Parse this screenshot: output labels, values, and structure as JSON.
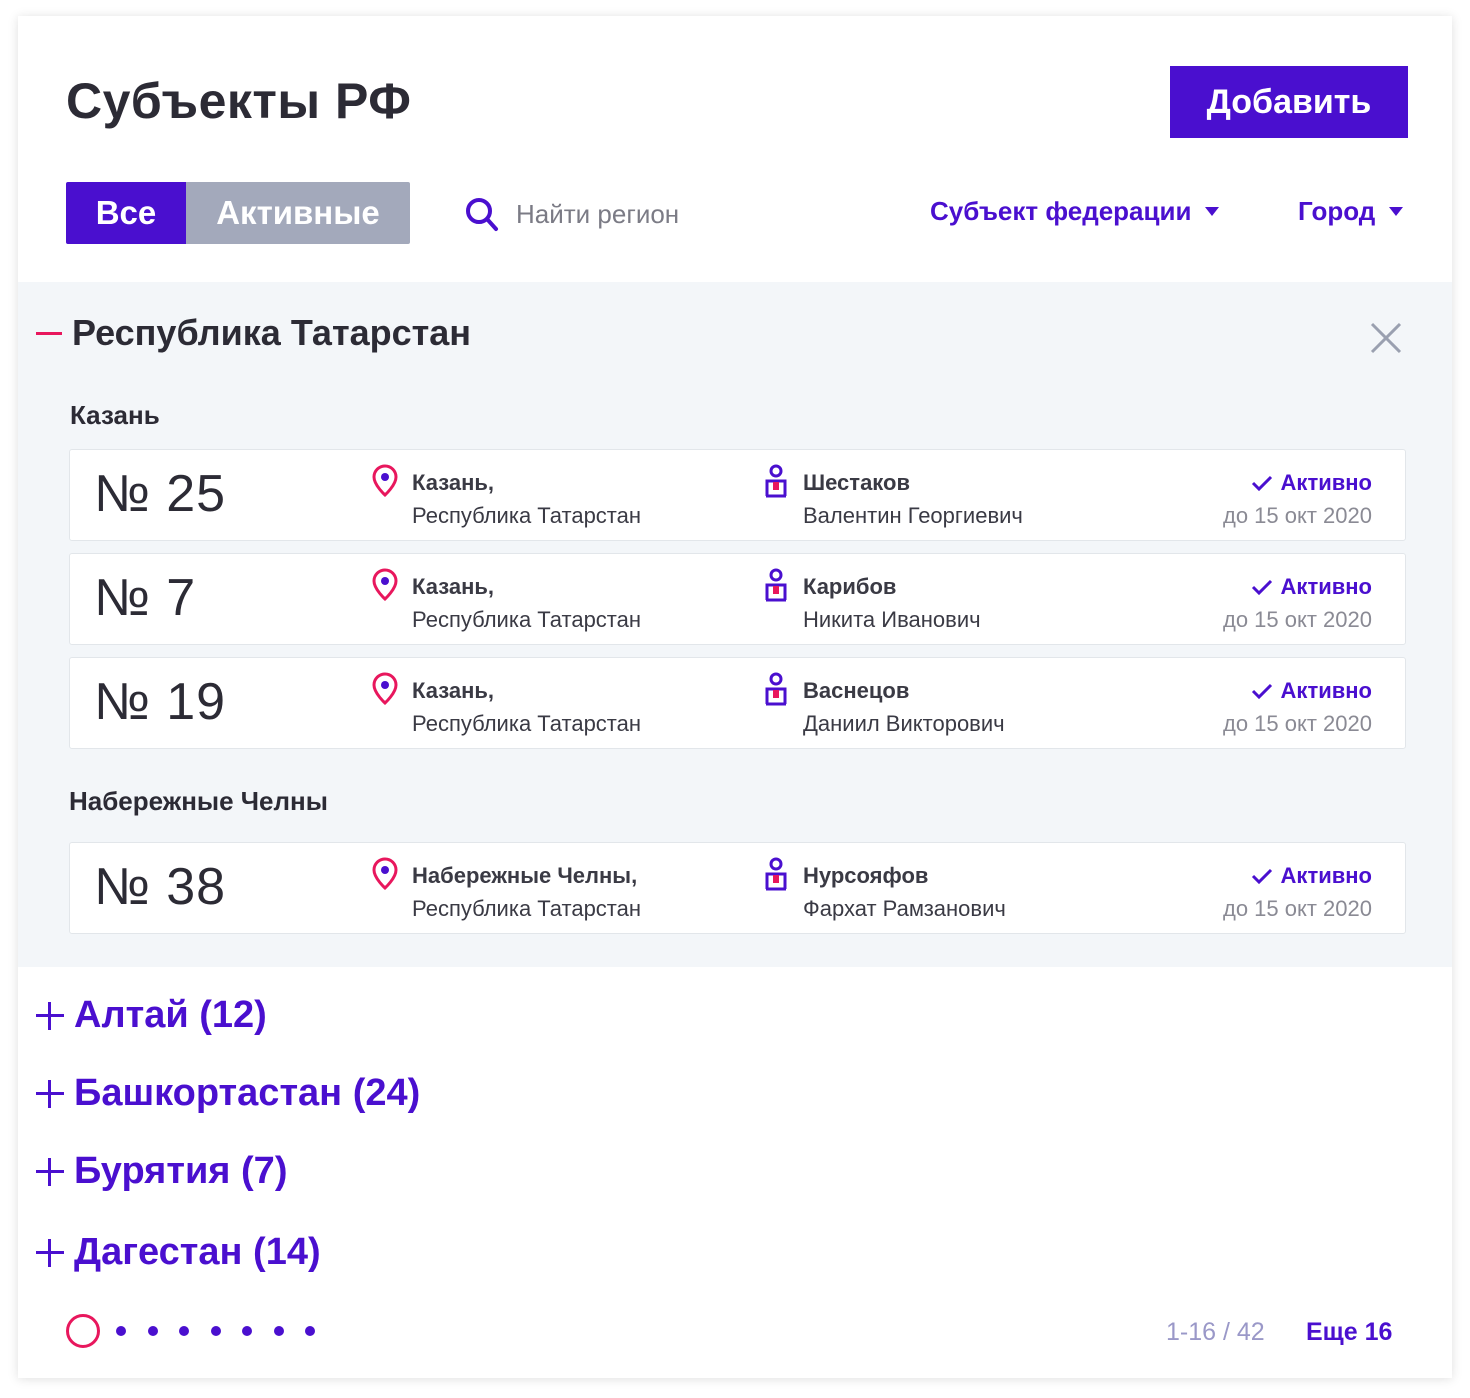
{
  "header": {
    "title": "Субъекты РФ",
    "add_label": "Добавить"
  },
  "filters": {
    "tabs": [
      {
        "label": "Все",
        "selected": true
      },
      {
        "label": "Активные",
        "selected": false
      }
    ],
    "search_placeholder": "Найти регион",
    "dropdown_subject": "Субъект федерации",
    "dropdown_city": "Город"
  },
  "expanded_region": {
    "title": "Республика Татарстан",
    "groups": [
      {
        "city": "Казань",
        "cards": [
          {
            "number": "№ 25",
            "loc1": "Казань,",
            "loc2": "Республика Татарстан",
            "person1": "Шестаков",
            "person2": "Валентин Георгиевич",
            "status": "Активно",
            "date": "до 15 окт 2020"
          },
          {
            "number": "№ 7",
            "loc1": "Казань,",
            "loc2": "Республика Татарстан",
            "person1": "Карибов",
            "person2": "Никита Иванович",
            "status": "Активно",
            "date": "до 15 окт 2020"
          },
          {
            "number": "№ 19",
            "loc1": "Казань,",
            "loc2": "Республика Татарстан",
            "person1": "Васнецов",
            "person2": "Даниил Викторович",
            "status": "Активно",
            "date": "до 15 окт 2020"
          }
        ]
      },
      {
        "city": "Набережные Челны",
        "cards": [
          {
            "number": "№ 38",
            "loc1": "Набережные Челны,",
            "loc2": "Республика Татарстан",
            "person1": "Нурсояфов",
            "person2": "Фархат Рамзанович",
            "status": "Активно",
            "date": "до 15 окт 2020"
          }
        ]
      }
    ]
  },
  "collapsed_regions": [
    "Алтай (12)",
    "Башкортастан (24)",
    "Бурятия (7)",
    "Дагестан (14)"
  ],
  "pagination": {
    "range": "1-16 / 42",
    "more": "Еще 16"
  },
  "colors": {
    "accent": "#4a0fcf",
    "pink": "#e8175d",
    "gray_tab": "#a3a9bb",
    "expanded_bg": "#f3f6f9"
  }
}
